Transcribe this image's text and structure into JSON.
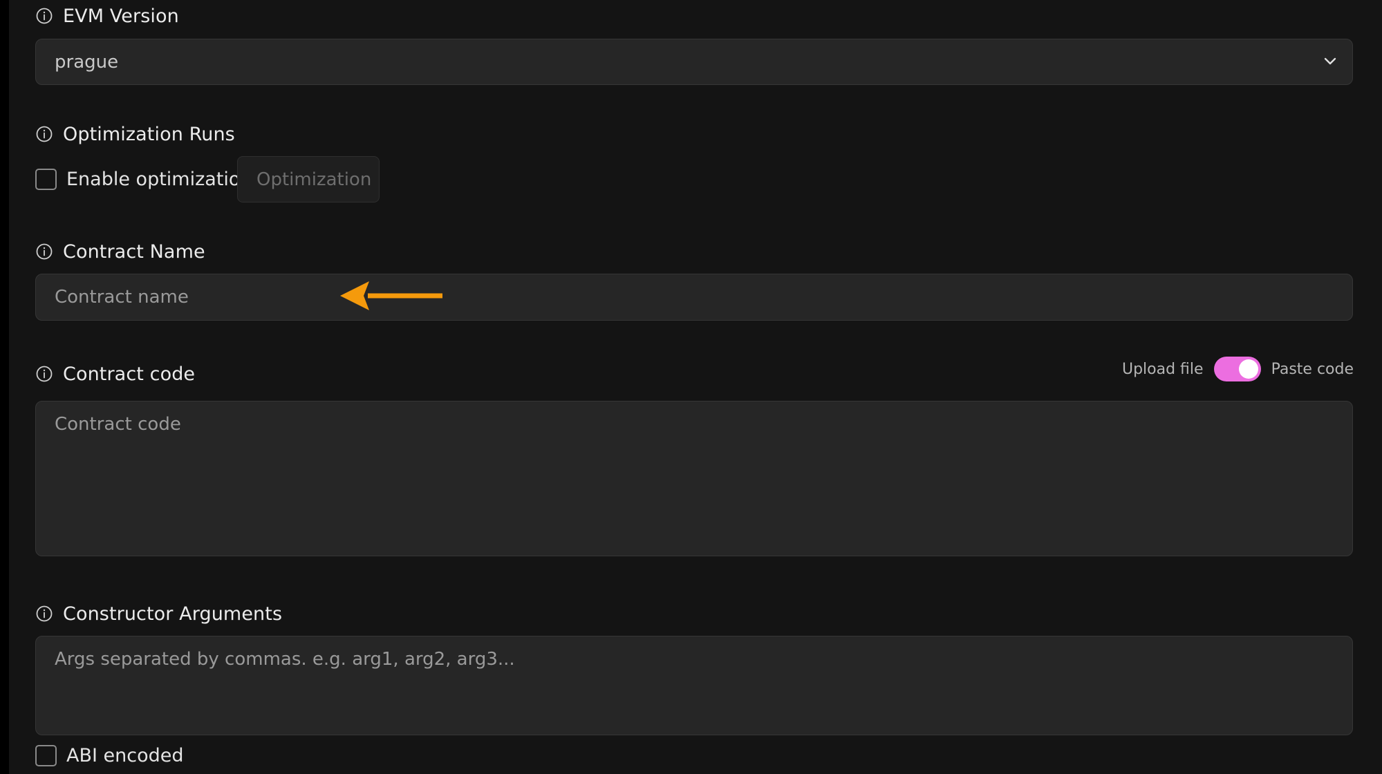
{
  "evm_version": {
    "label": "EVM Version",
    "selected_value": "prague"
  },
  "optimization_runs": {
    "label": "Optimization Runs",
    "enable_label": "Enable optimization",
    "enabled": false,
    "input_placeholder": "Optimization"
  },
  "contract_name": {
    "label": "Contract Name",
    "placeholder": "Contract name"
  },
  "contract_code": {
    "label": "Contract code",
    "placeholder": "Contract code",
    "toggle_left_label": "Upload file",
    "toggle_right_label": "Paste code",
    "toggle_state": "Paste code"
  },
  "constructor_arguments": {
    "label": "Constructor Arguments",
    "placeholder": "Args separated by commas. e.g. arg1, arg2, arg3...",
    "abi_label": "ABI encoded",
    "abi_checked": false
  },
  "icons": {
    "info": "info-icon",
    "chevron": "chevron-down-icon",
    "annotation_arrow": "arrow-left-icon"
  },
  "colors": {
    "background": "#141414",
    "field_background": "#262626",
    "toggle_accent": "#ec6ee0",
    "annotation_arrow": "#f59a0c"
  }
}
